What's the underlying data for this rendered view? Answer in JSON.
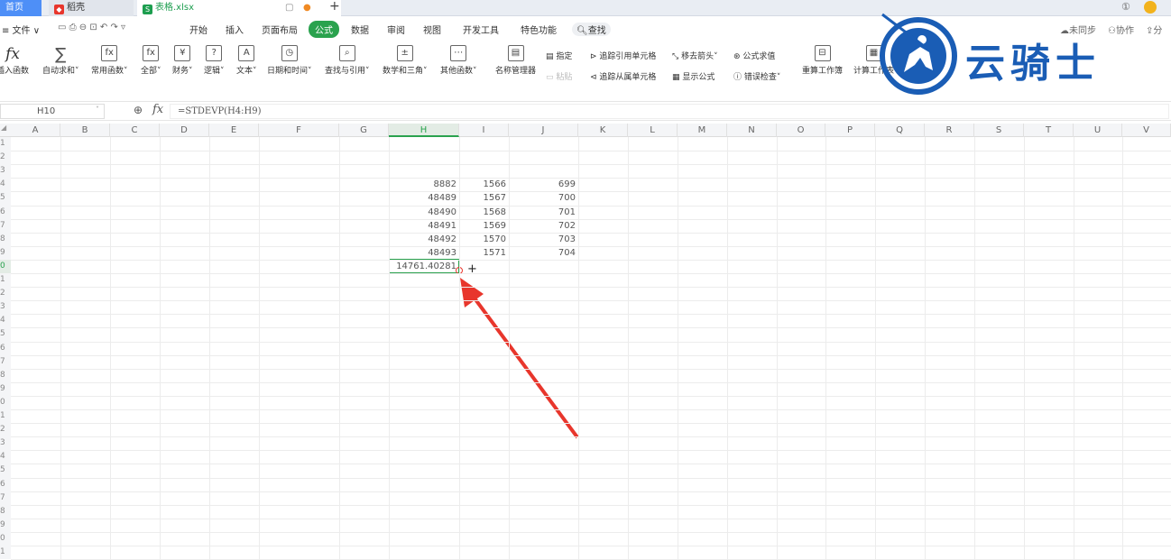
{
  "tabs": {
    "home": "首页",
    "docer": "稻壳",
    "file": "表格.xlsx"
  },
  "menu": [
    "≡ 文件 ∨",
    "开始",
    "插入",
    "页面布局",
    "公式",
    "数据",
    "审阅",
    "视图",
    "开发工具",
    "特色功能",
    "查找"
  ],
  "top_right": {
    "sync": "未同步",
    "collab": "协作",
    "share": "分"
  },
  "ribbon": {
    "insert_fn": "插入函数",
    "autosum": "自动求和",
    "common": "常用函数",
    "all": "全部",
    "finance": "财务",
    "logic": "逻辑",
    "text": "文本",
    "datetime": "日期和时间",
    "lookup": "查找与引用",
    "math": "数学和三角",
    "other": "其他函数",
    "name_mgr": "名称管理器",
    "specify": "指定",
    "paste": "粘贴",
    "trace_prec": "追踪引用单元格",
    "trace_dep": "追踪从属单元格",
    "remove_arrows": "移去箭头",
    "show_formula": "显示公式",
    "eval_formula": "公式求值",
    "error_check": "错误检查",
    "recalc_wb": "重算工作簿",
    "calc_sheet": "计算工作表"
  },
  "namebox": "H10",
  "formula": "=STDEVP(H4:H9)",
  "columns": [
    "A",
    "B",
    "C",
    "D",
    "E",
    "F",
    "G",
    "H",
    "I",
    "J",
    "K",
    "L",
    "M",
    "N",
    "O",
    "P",
    "Q",
    "R",
    "S",
    "T",
    "U",
    "V"
  ],
  "rows": [
    "1",
    "2",
    "3",
    "4",
    "5",
    "6",
    "7",
    "8",
    "9",
    "0",
    "1",
    "2",
    "3",
    "4",
    "5",
    "6",
    "7",
    "8",
    "9",
    "0",
    "1",
    "2",
    "3",
    "4",
    "5",
    "6",
    "7",
    "8",
    "9",
    "0",
    "1"
  ],
  "cells": {
    "H": [
      "8882",
      "48489",
      "48490",
      "48491",
      "48492",
      "48493",
      "14761.40281"
    ],
    "I": [
      "1566",
      "1567",
      "1568",
      "1569",
      "1570",
      "1571"
    ],
    "J": [
      "699",
      "700",
      "701",
      "702",
      "703",
      "704"
    ]
  },
  "watermark": "云骑士",
  "colors": {
    "accent": "#2aa24e",
    "arrow": "#e8362c",
    "logo": "#1a5db5"
  }
}
